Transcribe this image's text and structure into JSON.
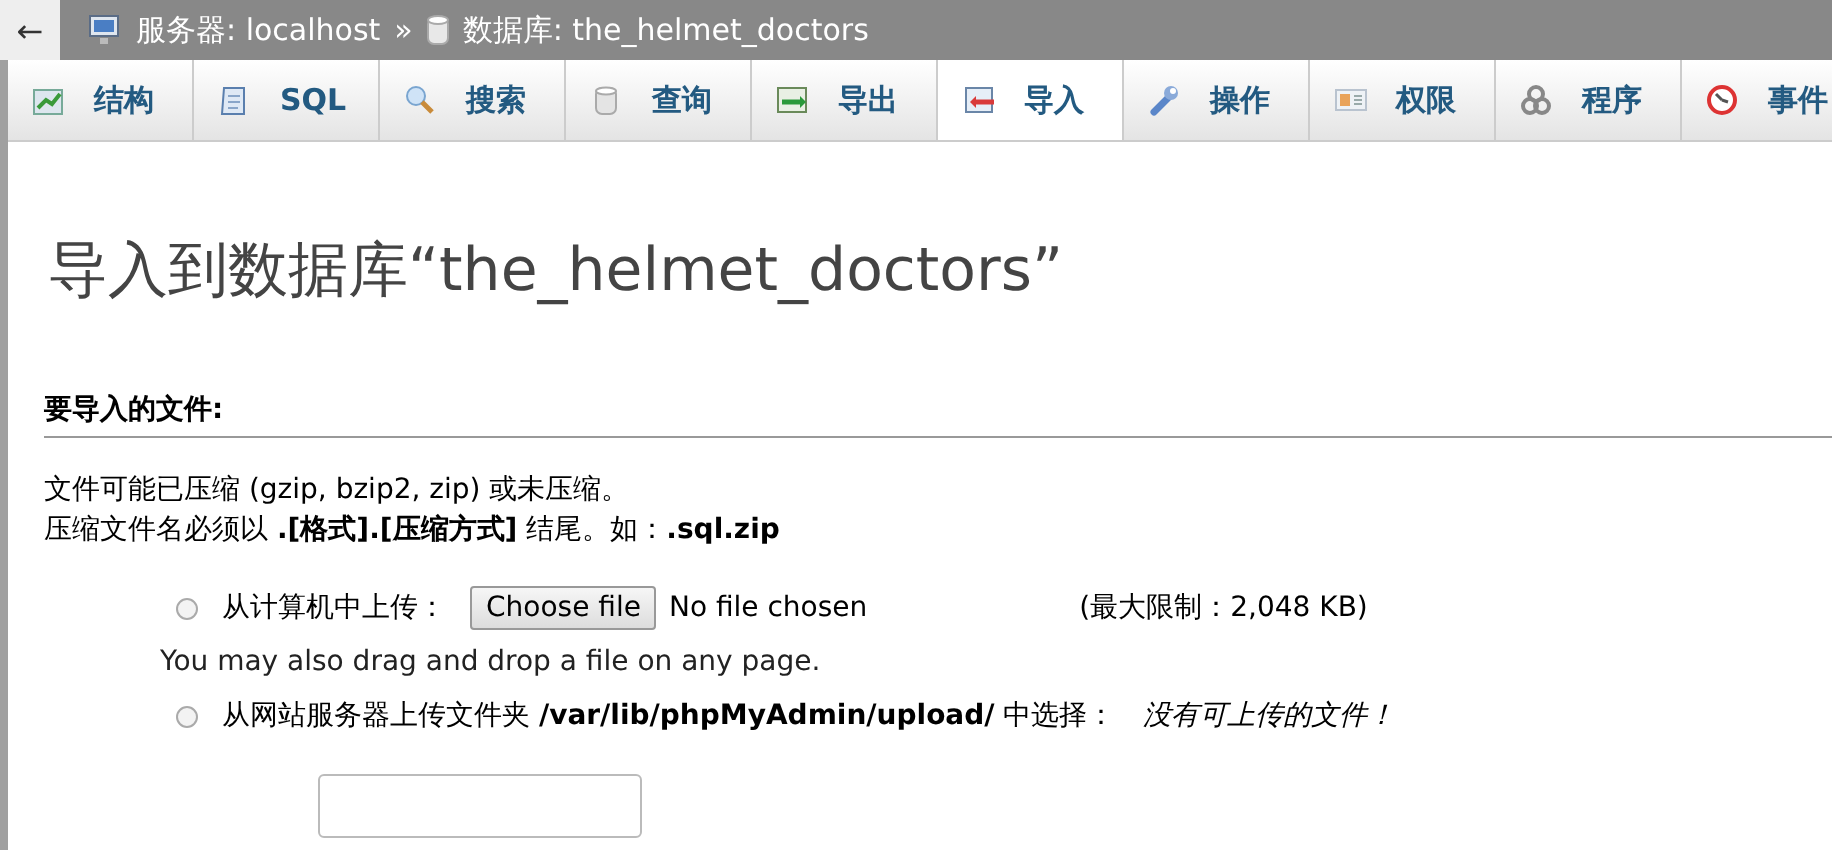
{
  "breadcrumb": {
    "back": "←",
    "server": "服务器: localhost",
    "separator": "»",
    "database": "数据库: the_helmet_doctors"
  },
  "tabs": [
    {
      "label": "结构",
      "selected": false
    },
    {
      "label": "SQL",
      "selected": false
    },
    {
      "label": "搜索",
      "selected": false
    },
    {
      "label": "查询",
      "selected": false
    },
    {
      "label": "导出",
      "selected": false
    },
    {
      "label": "导入",
      "selected": true
    },
    {
      "label": "操作",
      "selected": false
    },
    {
      "label": "权限",
      "selected": false
    },
    {
      "label": "程序",
      "selected": false
    },
    {
      "label": "事件",
      "selected": false
    }
  ],
  "page_title": "导入到数据库“the_helmet_doctors”",
  "section": {
    "heading": "要导入的文件:",
    "notes": [
      "文件可能已压缩 (gzip, bzip2, zip) 或未压缩。",
      "压缩文件名必须以 **.[格式].[压缩方式]** 结尾。如：**.sql.zip**"
    ],
    "options": [
      {
        "kind": "upload",
        "selected": false,
        "label": "从计算机中上传：",
        "button": "Choose file",
        "file_status": "No file chosen",
        "limit": "(最大限制：2,048 KB)",
        "hint": "You may also drag and drop a file on any page."
      },
      {
        "kind": "server",
        "selected": false,
        "label": "从网站服务器上传文件夹 **/var/lib/phpMyAdmin/upload/** 中选择：",
        "note": "没有可上传的文件！"
      }
    ]
  }
}
